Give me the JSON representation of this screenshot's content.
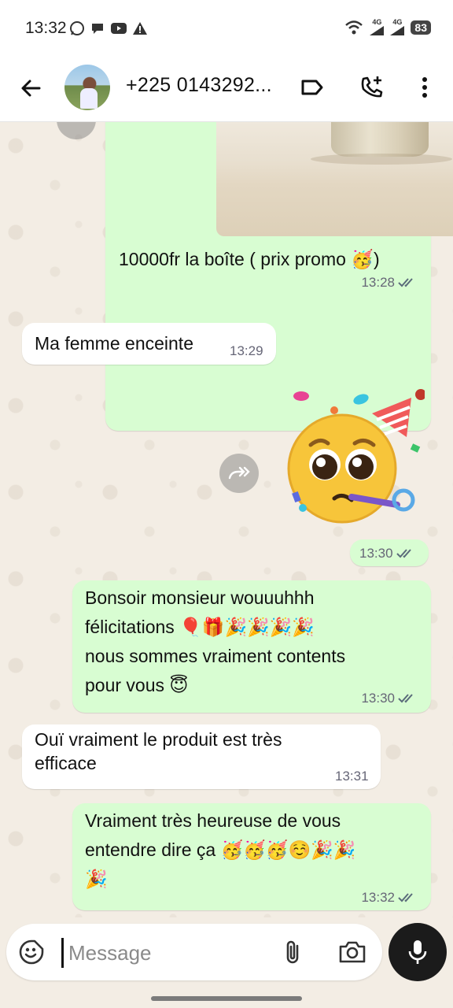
{
  "status_bar": {
    "time": "13:32",
    "left_icons": [
      "whatsapp-icon",
      "chat-bubble-icon",
      "youtube-icon",
      "warning-icon"
    ],
    "network_1": "4G",
    "network_2": "4G",
    "battery": "83"
  },
  "header": {
    "contact": "+225 0143292...",
    "icons": [
      "back-arrow-icon",
      "label-icon",
      "add-call-icon",
      "more-vert-icon"
    ]
  },
  "messages": [
    {
      "direction": "out",
      "type": "image-caption",
      "text": "10000fr la boîte ( prix promo 🥳)",
      "time": "13:28",
      "status": "read"
    },
    {
      "direction": "in",
      "type": "text",
      "text": "Ma femme enceinte",
      "time": "13:29"
    },
    {
      "direction": "out",
      "type": "sticker",
      "sticker": "party-pleading-face",
      "time": "13:30",
      "status": "read"
    },
    {
      "direction": "out",
      "type": "text",
      "lines": [
        "Bonsoir monsieur wouuuhhh",
        "félicitations 🎈🎁🎉🎉🎉🎉",
        "nous sommes vraiment contents",
        "pour vous 😇"
      ],
      "time": "13:30",
      "status": "read"
    },
    {
      "direction": "in",
      "type": "text",
      "lines": [
        "Ouï vraiment le produit est très",
        "efficace"
      ],
      "time": "13:31"
    },
    {
      "direction": "out",
      "type": "text",
      "lines": [
        "Vraiment très heureuse de vous",
        "entendre dire ça 🥳🥳🥳☺️🎉🎉",
        "🎉"
      ],
      "time": "13:32",
      "status": "read"
    }
  ],
  "composer": {
    "placeholder": "Message",
    "icons": [
      "emoji-sticker-icon",
      "paperclip-icon",
      "camera-icon",
      "microphone-icon"
    ]
  },
  "colors": {
    "outgoing_bubble": "#d8fdd2",
    "incoming_bubble": "#ffffff",
    "chat_background": "#f3ede4",
    "read_ticks": "#5a6b7a"
  }
}
